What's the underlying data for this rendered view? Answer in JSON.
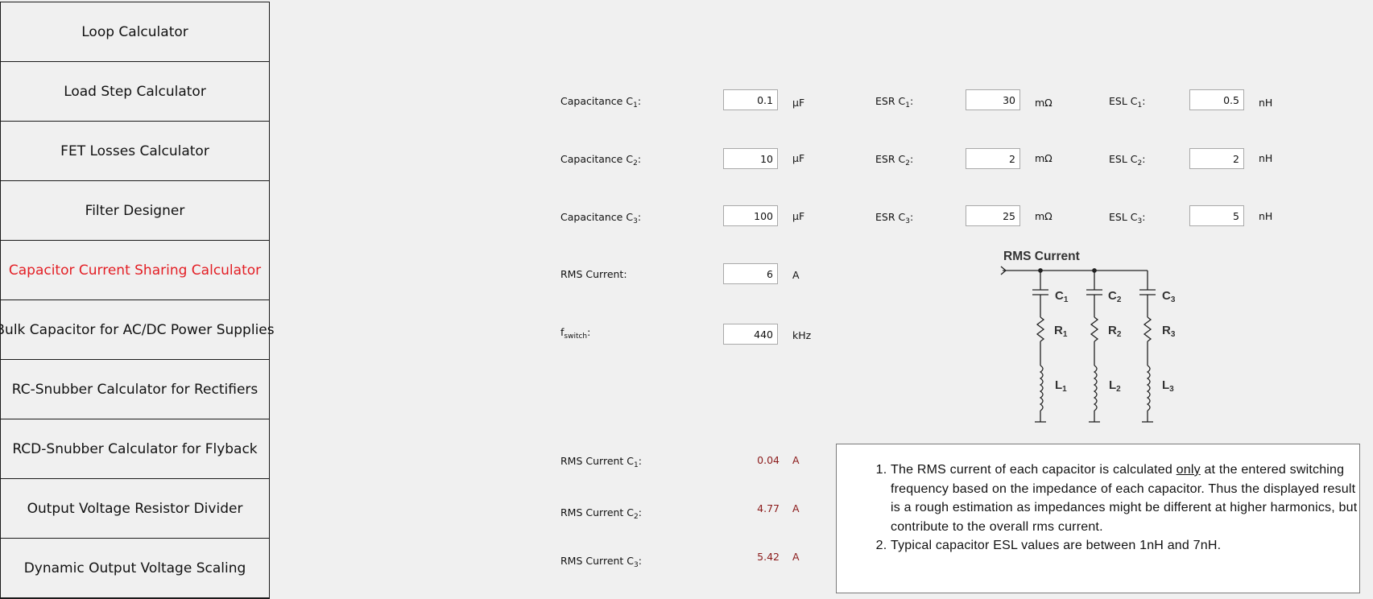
{
  "sidebar": {
    "items": [
      {
        "label": "Loop Calculator"
      },
      {
        "label": "Load Step Calculator"
      },
      {
        "label": "FET Losses Calculator"
      },
      {
        "label": "Filter Designer"
      },
      {
        "label": "Capacitor Current Sharing Calculator",
        "active": true
      },
      {
        "label": "Bulk Capacitor for AC/DC Power Supplies"
      },
      {
        "label": "RC-Snubber Calculator for Rectifiers"
      },
      {
        "label": "RCD-Snubber Calculator for Flyback"
      },
      {
        "label": "Output Voltage Resistor Divider"
      },
      {
        "label": "Dynamic Output Voltage Scaling"
      }
    ]
  },
  "inputs": {
    "cap1": {
      "label": "Capacitance C",
      "sub": "1",
      "value": "0.1",
      "unit": "µF"
    },
    "cap2": {
      "label": "Capacitance C",
      "sub": "2",
      "value": "10",
      "unit": "µF"
    },
    "cap3": {
      "label": "Capacitance C",
      "sub": "3",
      "value": "100",
      "unit": "µF"
    },
    "esr1": {
      "label": "ESR C",
      "sub": "1",
      "value": "30",
      "unit": "mΩ"
    },
    "esr2": {
      "label": "ESR C",
      "sub": "2",
      "value": "2",
      "unit": "mΩ"
    },
    "esr3": {
      "label": "ESR C",
      "sub": "3",
      "value": "25",
      "unit": "mΩ"
    },
    "esl1": {
      "label": "ESL C",
      "sub": "1",
      "value": "0.5",
      "unit": "nH"
    },
    "esl2": {
      "label": "ESL C",
      "sub": "2",
      "value": "2",
      "unit": "nH"
    },
    "esl3": {
      "label": "ESL C",
      "sub": "3",
      "value": "5",
      "unit": "nH"
    },
    "rms": {
      "label": "RMS Current:",
      "value": "6",
      "unit": "A"
    },
    "fsw": {
      "label": "f",
      "sub": "switch",
      "value": "440",
      "unit": "kHz"
    }
  },
  "results": {
    "r1": {
      "label": "RMS Current C",
      "sub": "1",
      "value": "0.04",
      "unit": "A"
    },
    "r2": {
      "label": "RMS Current C",
      "sub": "2",
      "value": "4.77",
      "unit": "A"
    },
    "r3": {
      "label": "RMS Current C",
      "sub": "3",
      "value": "5.42",
      "unit": "A"
    }
  },
  "diagram": {
    "title": "RMS Current",
    "labels": {
      "c1": "C",
      "c2": "C",
      "c3": "C",
      "r1": "R",
      "r2": "R",
      "r3": "R",
      "l1": "L",
      "l2": "L",
      "l3": "L"
    },
    "subs": {
      "n1": "1",
      "n2": "2",
      "n3": "3"
    }
  },
  "notes": {
    "n1_part1": "The RMS current of each capacitor is calculated ",
    "n1_underlined": "only",
    "n1_part2": " at the entered switching frequency based on the impedance of each capacitor. Thus the displayed result is a rough estimation as impedances might be different at higher harmonics, but contribute to the overall rms current.",
    "n2": "Typical capacitor ESL values are between 1nH and 7nH."
  }
}
